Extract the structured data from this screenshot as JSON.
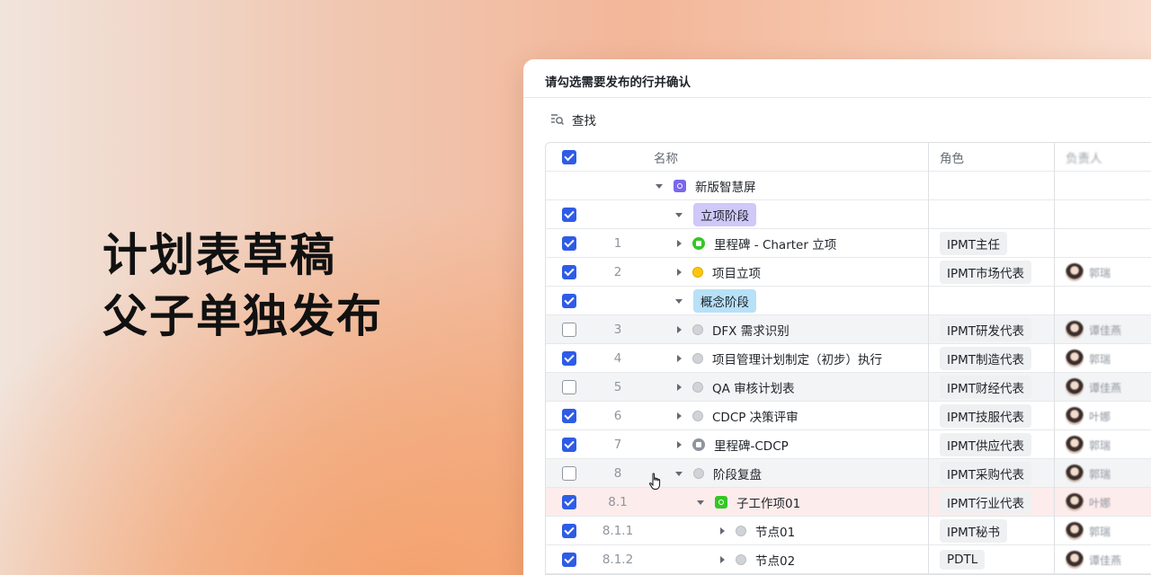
{
  "headline": {
    "line1": "计划表草稿",
    "line2": "父子单独发布"
  },
  "panel": {
    "title": "请勾选需要发布的行并确认",
    "find_label": "查找"
  },
  "columns": {
    "name": "名称",
    "role": "角色",
    "owner": "负责人"
  },
  "rows": [
    {
      "checked": null,
      "num": "",
      "indent": 0,
      "toggle": "down",
      "marker": "sq-purple",
      "name": "新版智慧屏",
      "name_style": "plain",
      "role": "",
      "owner": "",
      "bg": ""
    },
    {
      "checked": true,
      "num": "",
      "indent": 1,
      "toggle": "down",
      "marker": "",
      "name": "立项阶段",
      "name_style": "phase-purple",
      "role": "",
      "owner": "",
      "bg": ""
    },
    {
      "checked": true,
      "num": "1",
      "indent": 1,
      "toggle": "right",
      "marker": "ms-green",
      "name": "里程碑 - Charter 立项",
      "name_style": "plain",
      "role": "IPMT主任",
      "owner": "",
      "bg": ""
    },
    {
      "checked": true,
      "num": "2",
      "indent": 1,
      "toggle": "right",
      "marker": "dot-yellow",
      "name": "项目立项",
      "name_style": "plain",
      "role": "IPMT市场代表",
      "owner": "郭瑞",
      "bg": ""
    },
    {
      "checked": true,
      "num": "",
      "indent": 1,
      "toggle": "down",
      "marker": "",
      "name": "概念阶段",
      "name_style": "phase-blue",
      "role": "",
      "owner": "",
      "bg": ""
    },
    {
      "checked": false,
      "num": "3",
      "indent": 1,
      "toggle": "right",
      "marker": "dot-grey",
      "name": "DFX 需求识别",
      "name_style": "plain",
      "role": "IPMT研发代表",
      "owner": "谭佳燕",
      "bg": "hl"
    },
    {
      "checked": true,
      "num": "4",
      "indent": 1,
      "toggle": "right",
      "marker": "dot-grey",
      "name": "项目管理计划制定（初步）执行",
      "name_style": "plain",
      "role": "IPMT制造代表",
      "owner": "郭瑞",
      "bg": ""
    },
    {
      "checked": false,
      "num": "5",
      "indent": 1,
      "toggle": "right",
      "marker": "dot-grey",
      "name": "QA 审核计划表",
      "name_style": "plain",
      "role": "IPMT财经代表",
      "owner": "谭佳燕",
      "bg": "hl"
    },
    {
      "checked": true,
      "num": "6",
      "indent": 1,
      "toggle": "right",
      "marker": "dot-grey",
      "name": "CDCP 决策评审",
      "name_style": "plain",
      "role": "IPMT技服代表",
      "owner": "叶娜",
      "bg": ""
    },
    {
      "checked": true,
      "num": "7",
      "indent": 1,
      "toggle": "right",
      "marker": "ms-grey",
      "name": "里程碑-CDCP",
      "name_style": "plain",
      "role": "IPMT供应代表",
      "owner": "郭瑞",
      "bg": ""
    },
    {
      "checked": false,
      "num": "8",
      "indent": 1,
      "toggle": "down",
      "marker": "dot-grey",
      "name": "阶段复盘",
      "name_style": "plain",
      "role": "IPMT采购代表",
      "owner": "郭瑞",
      "bg": "hl"
    },
    {
      "checked": true,
      "num": "8.1",
      "indent": 2,
      "toggle": "down",
      "marker": "sq-green",
      "name": "子工作项01",
      "name_style": "plain",
      "role": "IPMT行业代表",
      "owner": "叶娜",
      "bg": "pink"
    },
    {
      "checked": true,
      "num": "8.1.1",
      "indent": 3,
      "toggle": "right",
      "marker": "dot-grey",
      "name": "节点01",
      "name_style": "plain",
      "role": "IPMT秘书",
      "owner": "郭瑞",
      "bg": ""
    },
    {
      "checked": true,
      "num": "8.1.2",
      "indent": 3,
      "toggle": "right",
      "marker": "dot-grey",
      "name": "节点02",
      "name_style": "plain",
      "role": "PDTL",
      "owner": "谭佳燕",
      "bg": ""
    }
  ],
  "colors": {
    "accent": "#2f5ce6",
    "phase_purple": "#cfc8f8",
    "phase_blue": "#b7e1f7",
    "milestone_green": "#34c724"
  }
}
